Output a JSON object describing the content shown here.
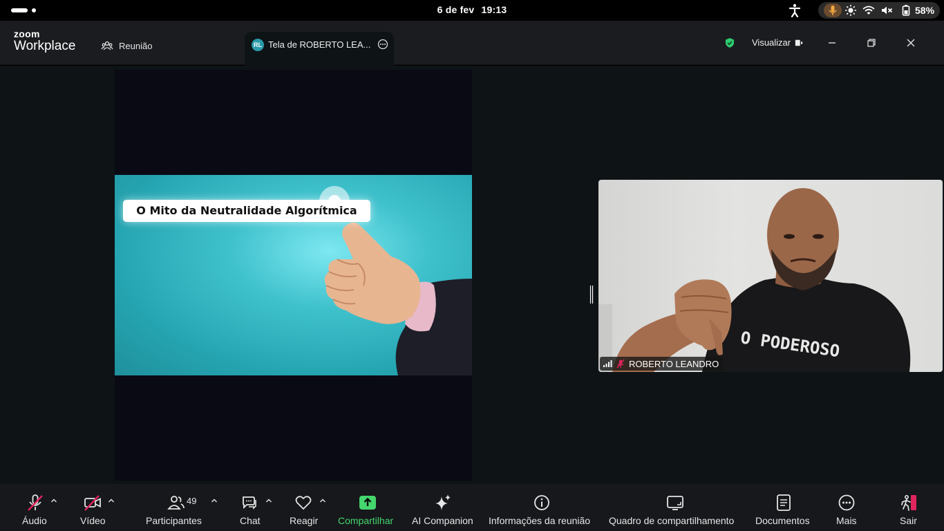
{
  "system": {
    "date": "6 de fev",
    "time": "19:13",
    "battery": "58%"
  },
  "titlebar": {
    "brand_top": "zoom",
    "brand_bottom": "Workplace",
    "meeting_tab": "Reunião",
    "share_tab_initials": "RL",
    "share_tab_label": "Tela de ROBERTO LEA...",
    "view_label": "Visualizar"
  },
  "stage": {
    "slide_title": "O Mito da Neutralidade Algorítmica",
    "participant_name": "ROBERTO LEANDRO",
    "shirt_text": "O PODEROSO"
  },
  "toolbar": {
    "audio": "Áudio",
    "video": "Vídeo",
    "participants": "Participantes",
    "participants_count": "49",
    "chat": "Chat",
    "react": "Reagir",
    "share": "Compartilhar",
    "ai_companion": "AI Companion",
    "meeting_info": "Informações da reunião",
    "whiteboard": "Quadro de compartilhamento",
    "docs": "Documentos",
    "more": "Mais",
    "leave": "Sair"
  },
  "colors": {
    "accent_green": "#45d66e",
    "muted_red": "#e0245e",
    "stage_bg": "#0e1316",
    "toolbar_bg": "#16181b"
  }
}
